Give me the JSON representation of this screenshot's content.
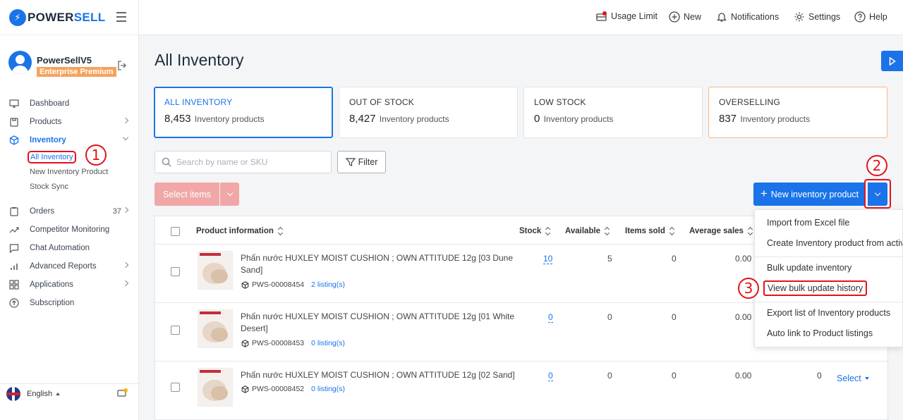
{
  "brand": {
    "name_part1": "POWER",
    "name_part2": "SELL",
    "color": "#1a73e8"
  },
  "user": {
    "name": "PowerSellV5",
    "plan": "Enterprise Premium"
  },
  "sidebar": {
    "items": [
      {
        "label": "Dashboard",
        "icon": "monitor-icon"
      },
      {
        "label": "Products",
        "icon": "box-icon"
      },
      {
        "label": "Inventory",
        "icon": "cube-icon"
      },
      {
        "label": "Orders",
        "icon": "clipboard-icon",
        "count": "37"
      },
      {
        "label": "Competitor Monitoring",
        "icon": "trend-icon"
      },
      {
        "label": "Chat Automation",
        "icon": "chat-icon"
      },
      {
        "label": "Advanced Reports",
        "icon": "bar-chart-icon"
      },
      {
        "label": "Applications",
        "icon": "grid-icon"
      },
      {
        "label": "Subscription",
        "icon": "upload-circle-icon"
      }
    ],
    "inventory_sub": [
      "All Inventory",
      "New Inventory Product",
      "Stock Sync"
    ],
    "language": "English"
  },
  "header": {
    "usage_limit": "Usage Limit",
    "new": "New",
    "notifications": "Notifications",
    "settings": "Settings",
    "help": "Help"
  },
  "page": {
    "title": "All Inventory"
  },
  "stats": [
    {
      "label": "ALL INVENTORY",
      "value": "8,453",
      "unit": "Inventory products"
    },
    {
      "label": "OUT OF STOCK",
      "value": "8,427",
      "unit": "Inventory products"
    },
    {
      "label": "LOW STOCK",
      "value": "0",
      "unit": "Inventory products"
    },
    {
      "label": "OVERSELLING",
      "value": "837",
      "unit": "Inventory products"
    }
  ],
  "toolbar": {
    "search_placeholder": "Search by name or SKU",
    "filter": "Filter",
    "select_items": "Select items",
    "new_inventory": "New inventory product"
  },
  "table": {
    "headers": [
      "Product information",
      "Stock",
      "Available",
      "Items sold",
      "Average sales"
    ],
    "rows": [
      {
        "name": "Phấn nước HUXLEY MOIST CUSHION ; OWN ATTITUDE 12g [03 Dune Sand]",
        "sku": "PWS-00008454",
        "listing": "2 listing(s)",
        "stock": "10",
        "available": "5",
        "sold": "0",
        "avg": "0.00"
      },
      {
        "name": "Phấn nước HUXLEY MOIST CUSHION ; OWN ATTITUDE 12g [01 White Desert]",
        "sku": "PWS-00008453",
        "listing": "0 listing(s)",
        "stock": "0",
        "available": "0",
        "sold": "0",
        "avg": "0.00"
      },
      {
        "name": "Phấn nước HUXLEY MOIST CUSHION ; OWN ATTITUDE 12g [02 Sand]",
        "sku": "PWS-00008452",
        "listing": "0 listing(s)",
        "stock": "0",
        "available": "0",
        "sold": "0",
        "avg": "0.00",
        "extra": "0",
        "action": "Select"
      }
    ]
  },
  "menu": {
    "items": [
      "Import from Excel file",
      "Create Inventory product from active",
      "Bulk update inventory",
      "View bulk update history",
      "Export list of Inventory products",
      "Auto link to Product listings"
    ]
  },
  "steps": [
    "1",
    "2",
    "3"
  ]
}
